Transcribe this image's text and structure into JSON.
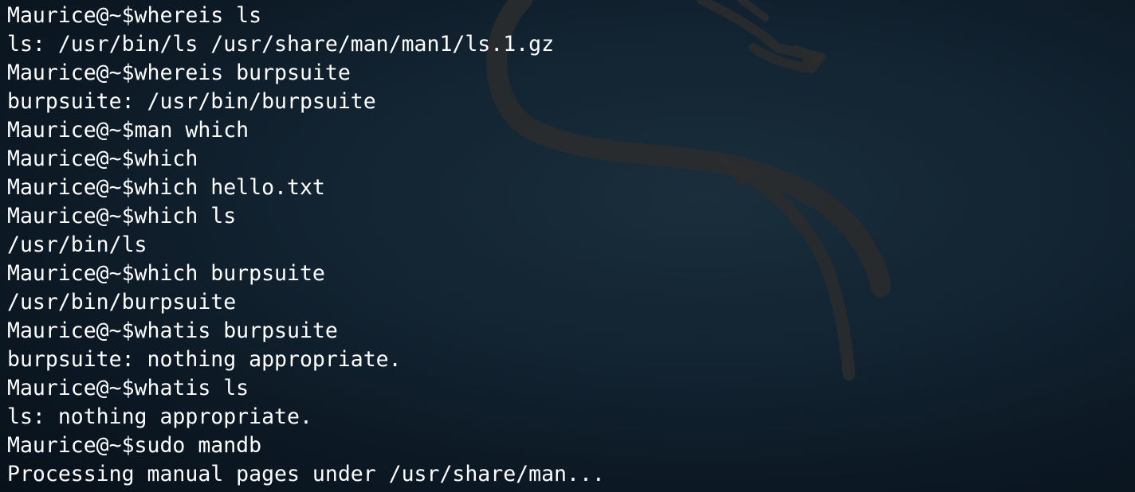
{
  "terminal": {
    "background_color": "#0b1722",
    "text_color": "#ffffff",
    "wallpaper_icon": "kali-dragon-icon",
    "lines": [
      "Maurice@~$whereis ls",
      "ls: /usr/bin/ls /usr/share/man/man1/ls.1.gz",
      "Maurice@~$whereis burpsuite",
      "burpsuite: /usr/bin/burpsuite",
      "Maurice@~$man which",
      "Maurice@~$which",
      "Maurice@~$which hello.txt",
      "Maurice@~$which ls",
      "/usr/bin/ls",
      "Maurice@~$which burpsuite",
      "/usr/bin/burpsuite",
      "Maurice@~$whatis burpsuite",
      "burpsuite: nothing appropriate.",
      "Maurice@~$whatis ls",
      "ls: nothing appropriate.",
      "Maurice@~$sudo mandb",
      "Processing manual pages under /usr/share/man..."
    ]
  }
}
